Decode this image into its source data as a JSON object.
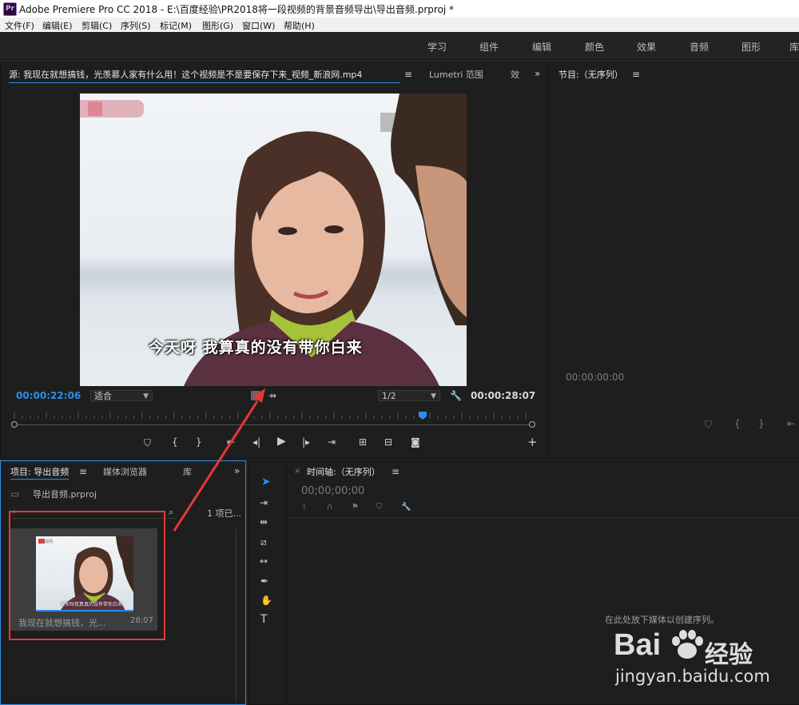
{
  "titlebar": {
    "app_logo": "Pr",
    "title": "Adobe Premiere Pro CC 2018 - E:\\百度经验\\PR2018将一段视频的背景音频导出\\导出音频.prproj *"
  },
  "menu": [
    "文件(F)",
    "编辑(E)",
    "剪辑(C)",
    "序列(S)",
    "标记(M)",
    "图形(G)",
    "窗口(W)",
    "帮助(H)"
  ],
  "workspaces": [
    "学习",
    "组件",
    "编辑",
    "颜色",
    "效果",
    "音频",
    "图形",
    "库"
  ],
  "source": {
    "tab_label": "源: 我现在就想搞钱，光羡慕人家有什么用！这个视频是不是要保存下来_视频_新浪网.mp4",
    "tab2": "Lumetri 范围",
    "tab3": "效",
    "subtitle": "今天呀 我算真的没有带你白来",
    "timecode_in": "00:00:22:06",
    "fit": "适合",
    "resolution": "1/2",
    "duration": "00:00:28:07",
    "playhead_fraction": 0.785
  },
  "program": {
    "tab_label": "节目:（无序列）",
    "timecode": "00:00:00:00"
  },
  "project": {
    "tab_label": "项目: 导出音频",
    "tab2": "媒体浏览器",
    "tab3": "库",
    "file": "导出音频.prproj",
    "items_count": "1 项已...",
    "clip_name": "我现在就想搞钱，光...",
    "clip_duration": "28:07",
    "thumb_subtitle": "今天呀我算真的没有带你白来",
    "thumb_logo": "新浪网"
  },
  "timeline": {
    "tab_label": "时间轴:（无序列）",
    "timecode": "00;00;00;00",
    "drop_hint": "在此处放下媒体以创建序列。"
  },
  "watermark": {
    "brand_left": "Bai",
    "brand_right": "经验",
    "url": "jingyan.baidu.com"
  },
  "colors": {
    "accent": "#2d8ceb",
    "highlight": "#e53935"
  }
}
